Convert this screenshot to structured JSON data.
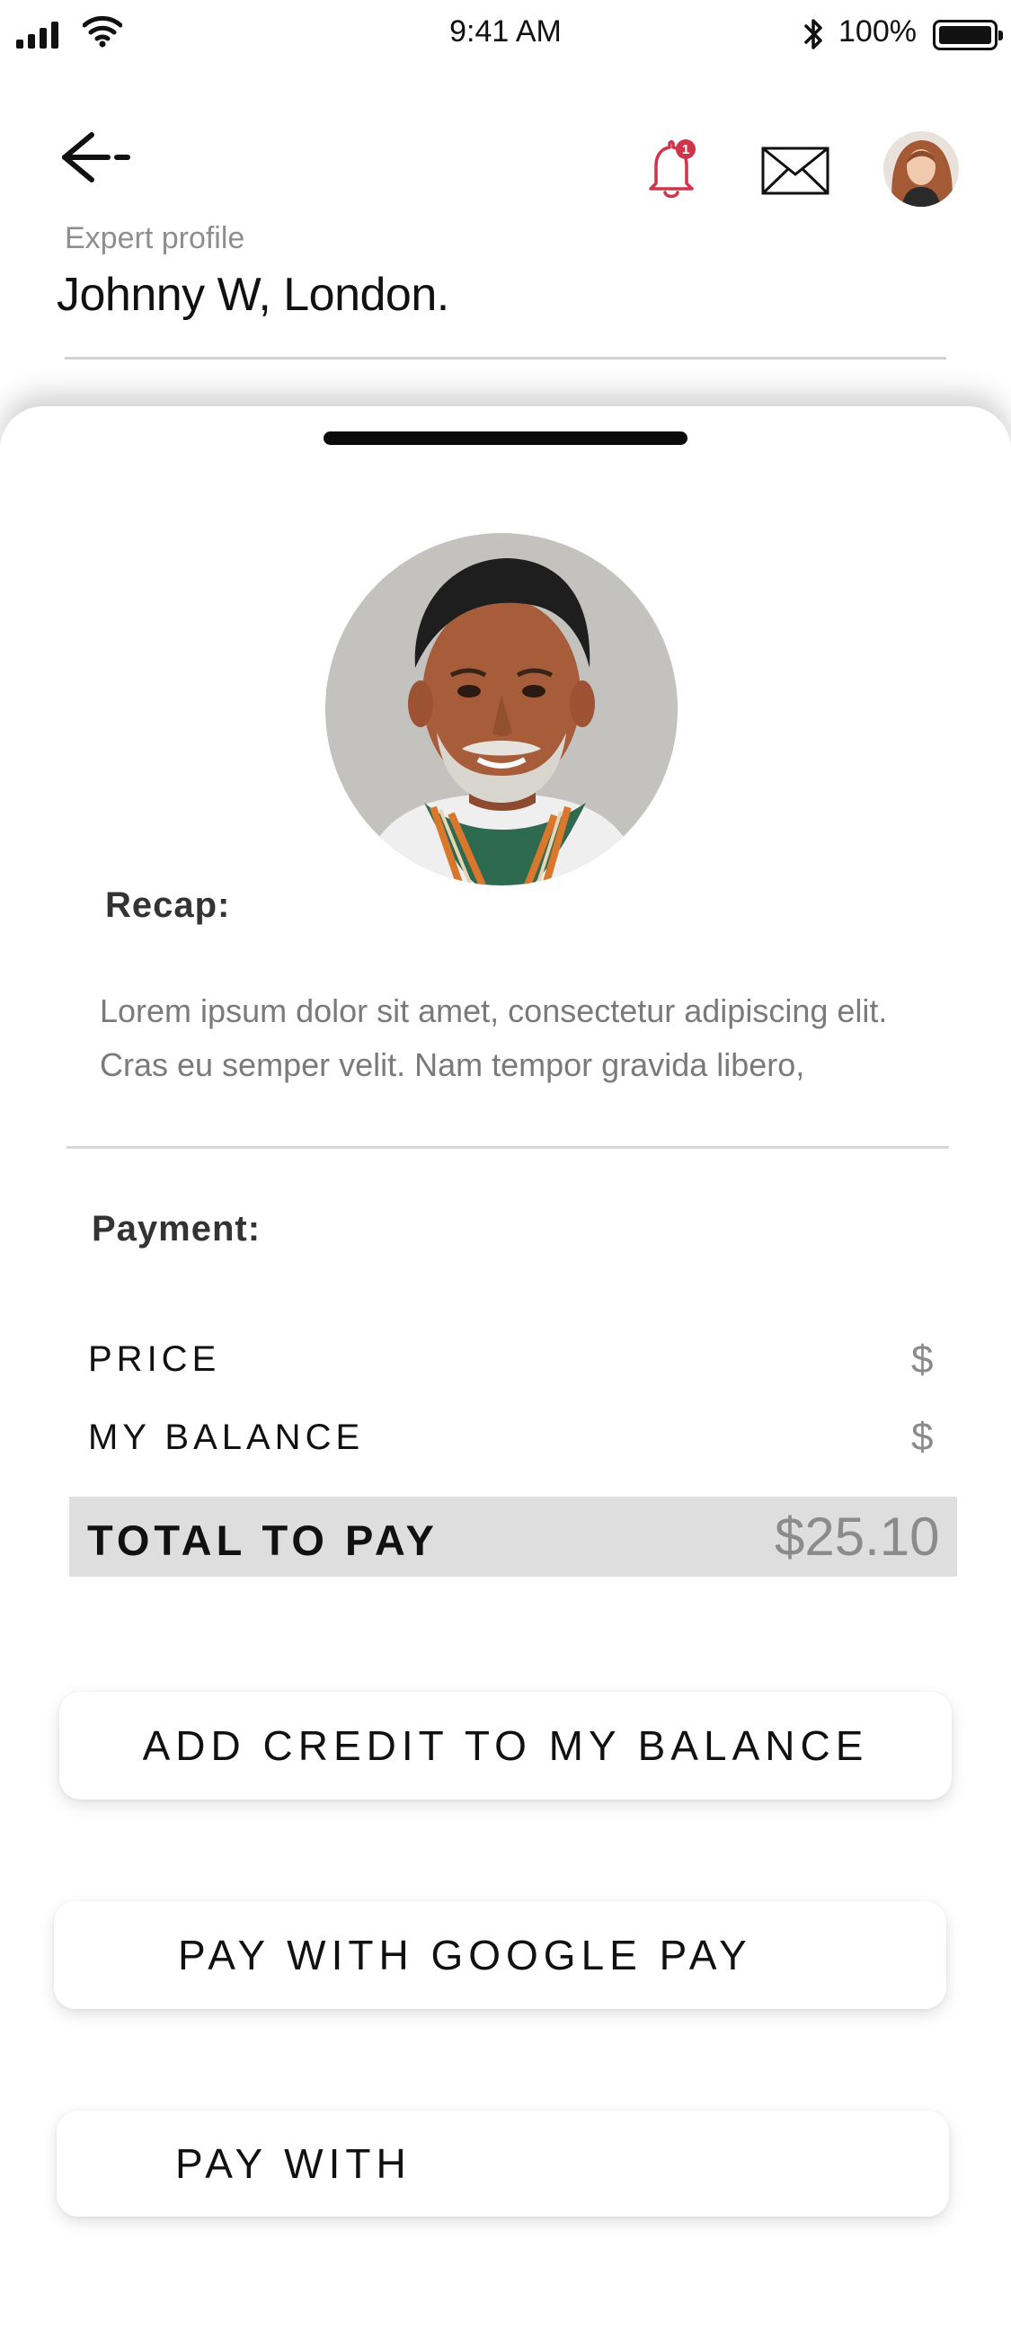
{
  "status_bar": {
    "time": "9:41 AM",
    "battery_percent": "100%",
    "icons": [
      "cellular-signal-icon",
      "wifi-icon",
      "bluetooth-icon",
      "battery-icon"
    ]
  },
  "header": {
    "back_icon": "arrow-left-icon",
    "notification_count": "1",
    "eyebrow": "Expert profile",
    "title": "Johnny W, London."
  },
  "recap": {
    "heading": "Recap:",
    "text": "Lorem ipsum dolor sit amet, consectetur adipiscing elit. Cras eu semper velit. Nam tempor gravida libero,"
  },
  "payment": {
    "heading": "Payment:",
    "price_label": "PRICE",
    "price_value": "$",
    "balance_label": "MY BALANCE",
    "balance_value": "$",
    "total_label": "TOTAL TO PAY",
    "total_value": "$25.10"
  },
  "actions": {
    "add_credit": "ADD CREDIT TO MY BALANCE",
    "google_pay": "PAY WITH GOOGLE PAY",
    "pay_with": "PAY WITH"
  },
  "colors": {
    "notification_red": "#d0344a",
    "total_bar": "#dedede",
    "muted_text": "#8b8b8b"
  }
}
